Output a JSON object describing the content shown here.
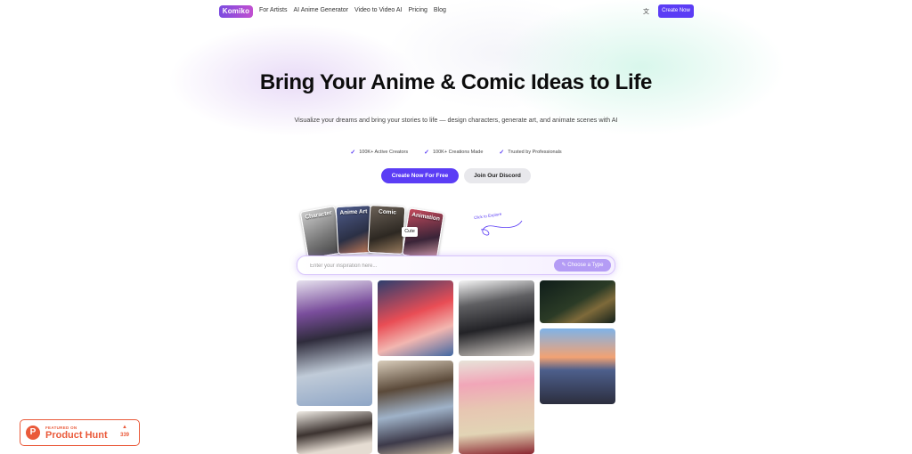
{
  "nav": {
    "logo": "Komiko",
    "links": [
      "For Artists",
      "AI Anime Generator",
      "Video to Video AI",
      "Pricing",
      "Blog"
    ],
    "lang_icon": "translate-icon",
    "cta": "Create Now"
  },
  "hero": {
    "title": "Bring Your Anime & Comic Ideas to Life",
    "subtitle": "Visualize your dreams and bring your stories to life — design characters, generate art, and animate scenes with AI",
    "stats": [
      "100K+ Active Creators",
      "100K+ Creations Made",
      "Trusted by Professionals"
    ],
    "primary_button": "Create Now For Free",
    "secondary_button": "Join Our Discord"
  },
  "categories": {
    "cards": [
      "Character",
      "Anime Art",
      "Comic",
      "Animation"
    ],
    "tag": "Cute",
    "hint": "Click to Explore"
  },
  "search": {
    "placeholder": "Enter your inspiration here...",
    "type_button": "Choose a Type"
  },
  "product_hunt": {
    "featured": "FEATURED ON",
    "name": "Product Hunt",
    "votes": "339"
  },
  "colors": {
    "accent": "#5b3df5",
    "product_hunt": "#ea5a3a"
  }
}
